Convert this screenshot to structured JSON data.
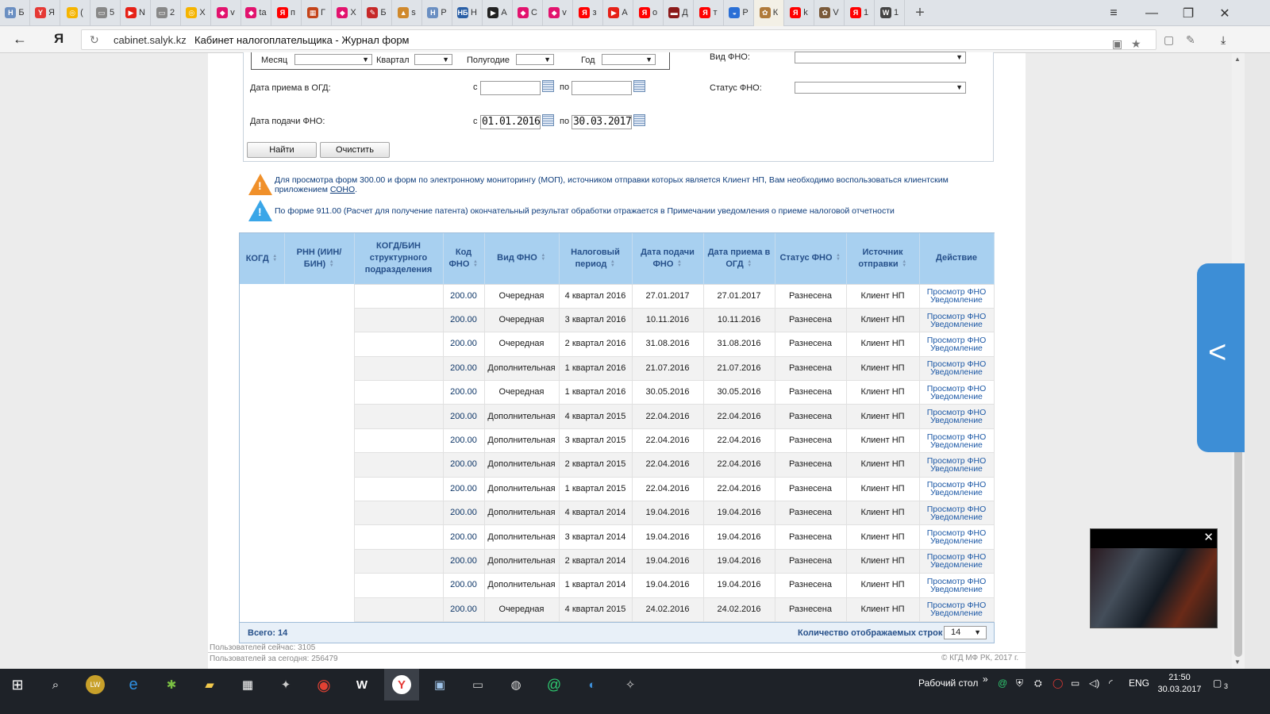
{
  "browser": {
    "tabs": [
      {
        "icon": "Н",
        "label": "Б",
        "color": "#6a8fc2"
      },
      {
        "icon": "Y",
        "label": "Я",
        "color": "#e53935"
      },
      {
        "icon": "◎",
        "label": "(",
        "color": "#f5b400"
      },
      {
        "icon": "▭",
        "label": "5",
        "color": "#888888"
      },
      {
        "icon": "▶",
        "label": "N",
        "color": "#e62117"
      },
      {
        "icon": "▭",
        "label": "2",
        "color": "#888888"
      },
      {
        "icon": "◎",
        "label": "Х",
        "color": "#f5b400"
      },
      {
        "icon": "◆",
        "label": "v",
        "color": "#e2136e"
      },
      {
        "icon": "◆",
        "label": "ta",
        "color": "#e2136e"
      },
      {
        "icon": "Я",
        "label": "п",
        "color": "#ff0000"
      },
      {
        "icon": "▦",
        "label": "Г",
        "color": "#c4441a"
      },
      {
        "icon": "◆",
        "label": "Х",
        "color": "#e2136e"
      },
      {
        "icon": "✎",
        "label": "Б",
        "color": "#c62828"
      },
      {
        "icon": "▲",
        "label": "s",
        "color": "#d0892c"
      },
      {
        "icon": "Н",
        "label": "Р",
        "color": "#6a8fc2"
      },
      {
        "icon": "НБ",
        "label": "Н",
        "color": "#2a5fa6"
      },
      {
        "icon": "▶",
        "label": "А",
        "color": "#222222"
      },
      {
        "icon": "◆",
        "label": "С",
        "color": "#e2136e"
      },
      {
        "icon": "◆",
        "label": "v",
        "color": "#e2136e"
      },
      {
        "icon": "Я",
        "label": "з",
        "color": "#ff0000"
      },
      {
        "icon": "▶",
        "label": "А",
        "color": "#e62117"
      },
      {
        "icon": "Я",
        "label": "о",
        "color": "#ff0000"
      },
      {
        "icon": "▬",
        "label": "Д",
        "color": "#8b1a1a"
      },
      {
        "icon": "Я",
        "label": "т",
        "color": "#ff0000"
      },
      {
        "icon": "◒",
        "label": "Р",
        "color": "#2a6fd6"
      },
      {
        "icon": "✿",
        "label": "К",
        "color": "#b07a3a"
      },
      {
        "icon": "Я",
        "label": "k",
        "color": "#ff0000"
      },
      {
        "icon": "✿",
        "label": "V",
        "color": "#7a5a3a"
      },
      {
        "icon": "Я",
        "label": "1",
        "color": "#ff0000"
      },
      {
        "icon": "W",
        "label": "1",
        "color": "#444444"
      }
    ],
    "active_tab_index": 25,
    "address": {
      "domain": "cabinet.salyk.kz",
      "page_title": "Кабинет налогоплательщика - Журнал форм",
      "yandex_label": "Я"
    }
  },
  "filters": {
    "month_label": "Месяц",
    "quarter_label": "Квартал",
    "halfyear_label": "Полугодие",
    "year_label": "Год",
    "fno_type_label": "Вид ФНО:",
    "receipt_date_label": "Дата приема в ОГД:",
    "submit_date_label": "Дата подачи ФНО:",
    "from_label": "с",
    "to_label": "по",
    "receipt_from": "",
    "receipt_to": "",
    "submit_from": "01.01.2016",
    "submit_to": "30.03.2017",
    "status_label": "Статус ФНО:",
    "find_button": "Найти",
    "clear_button": "Очистить"
  },
  "notes": {
    "note1_text": "Для просмотра форм 300.00 и форм по электронному мониторингу (МОП), источником отправки которых является Клиент НП, Вам необходимо воспользоваться клиентским приложением",
    "note1_link": "СОНО",
    "note2_text": "По форме 911.00 (Расчет для получение патента) окончательный результат обработки отражается в Примечании уведомления о приеме налоговой отчетности",
    "warning_color": "#f0902a",
    "info_color": "#3aa6e8"
  },
  "table": {
    "columns": [
      "КОГД",
      "РНН (ИИН/ БИН)",
      "КОГД/БИН структурного подразделения",
      "Код ФНО",
      "Вид ФНО",
      "Налоговый период",
      "Дата подачи ФНО",
      "Дата приема в ОГД",
      "Статус ФНО",
      "Источник отправки",
      "Действие"
    ],
    "sortable": [
      true,
      true,
      false,
      true,
      true,
      true,
      true,
      true,
      true,
      true,
      false
    ],
    "rows": [
      {
        "code": "200.00",
        "type": "Очередная",
        "period": "4 квартал 2016",
        "submitted": "27.01.2017",
        "received": "27.01.2017",
        "status": "Разнесена",
        "source": "Клиент НП",
        "action1": "Просмотр ФНО",
        "action2": "Уведомление"
      },
      {
        "code": "200.00",
        "type": "Очередная",
        "period": "3 квартал 2016",
        "submitted": "10.11.2016",
        "received": "10.11.2016",
        "status": "Разнесена",
        "source": "Клиент НП",
        "action1": "Просмотр ФНО",
        "action2": "Уведомление"
      },
      {
        "code": "200.00",
        "type": "Очередная",
        "period": "2 квартал 2016",
        "submitted": "31.08.2016",
        "received": "31.08.2016",
        "status": "Разнесена",
        "source": "Клиент НП",
        "action1": "Просмотр ФНО",
        "action2": "Уведомление"
      },
      {
        "code": "200.00",
        "type": "Дополнительная",
        "period": "1 квартал 2016",
        "submitted": "21.07.2016",
        "received": "21.07.2016",
        "status": "Разнесена",
        "source": "Клиент НП",
        "action1": "Просмотр ФНО",
        "action2": "Уведомление"
      },
      {
        "code": "200.00",
        "type": "Очередная",
        "period": "1 квартал 2016",
        "submitted": "30.05.2016",
        "received": "30.05.2016",
        "status": "Разнесена",
        "source": "Клиент НП",
        "action1": "Просмотр ФНО",
        "action2": "Уведомление"
      },
      {
        "code": "200.00",
        "type": "Дополнительная",
        "period": "4 квартал 2015",
        "submitted": "22.04.2016",
        "received": "22.04.2016",
        "status": "Разнесена",
        "source": "Клиент НП",
        "action1": "Просмотр ФНО",
        "action2": "Уведомление"
      },
      {
        "code": "200.00",
        "type": "Дополнительная",
        "period": "3 квартал 2015",
        "submitted": "22.04.2016",
        "received": "22.04.2016",
        "status": "Разнесена",
        "source": "Клиент НП",
        "action1": "Просмотр ФНО",
        "action2": "Уведомление"
      },
      {
        "code": "200.00",
        "type": "Дополнительная",
        "period": "2 квартал 2015",
        "submitted": "22.04.2016",
        "received": "22.04.2016",
        "status": "Разнесена",
        "source": "Клиент НП",
        "action1": "Просмотр ФНО",
        "action2": "Уведомление"
      },
      {
        "code": "200.00",
        "type": "Дополнительная",
        "period": "1 квартал 2015",
        "submitted": "22.04.2016",
        "received": "22.04.2016",
        "status": "Разнесена",
        "source": "Клиент НП",
        "action1": "Просмотр ФНО",
        "action2": "Уведомление"
      },
      {
        "code": "200.00",
        "type": "Дополнительная",
        "period": "4 квартал 2014",
        "submitted": "19.04.2016",
        "received": "19.04.2016",
        "status": "Разнесена",
        "source": "Клиент НП",
        "action1": "Просмотр ФНО",
        "action2": "Уведомление"
      },
      {
        "code": "200.00",
        "type": "Дополнительная",
        "period": "3 квартал 2014",
        "submitted": "19.04.2016",
        "received": "19.04.2016",
        "status": "Разнесена",
        "source": "Клиент НП",
        "action1": "Просмотр ФНО",
        "action2": "Уведомление"
      },
      {
        "code": "200.00",
        "type": "Дополнительная",
        "period": "2 квартал 2014",
        "submitted": "19.04.2016",
        "received": "19.04.2016",
        "status": "Разнесена",
        "source": "Клиент НП",
        "action1": "Просмотр ФНО",
        "action2": "Уведомление"
      },
      {
        "code": "200.00",
        "type": "Дополнительная",
        "period": "1 квартал 2014",
        "submitted": "19.04.2016",
        "received": "19.04.2016",
        "status": "Разнесена",
        "source": "Клиент НП",
        "action1": "Просмотр ФНО",
        "action2": "Уведомление"
      },
      {
        "code": "200.00",
        "type": "Очередная",
        "period": "4 квартал 2015",
        "submitted": "24.02.2016",
        "received": "24.02.2016",
        "status": "Разнесена",
        "source": "Клиент НП",
        "action1": "Просмотр ФНО",
        "action2": "Уведомление"
      }
    ],
    "total": "Всего: 14",
    "rows_count_label": "Количество отображаемых строк",
    "rows_count_value": "14"
  },
  "footer": {
    "users_now": "Пользователей сейчас: 3105",
    "users_today": "Пользователей за сегодня: 256479",
    "copyright": "© КГД МФ РК, 2017 г."
  },
  "taskbar": {
    "desktop_label": "Рабочий стол",
    "lang": "ENG",
    "time": "21:50",
    "date": "30.03.2017",
    "notifications": "3"
  }
}
